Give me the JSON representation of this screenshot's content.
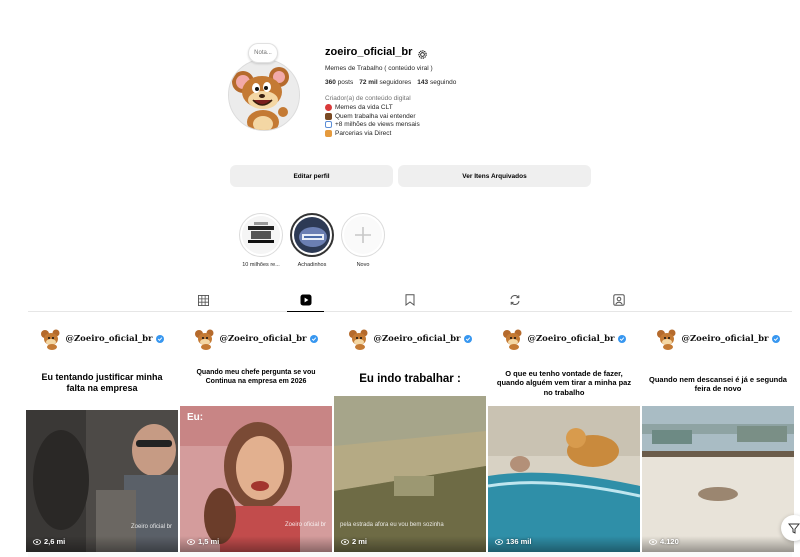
{
  "profile": {
    "note_label": "Nota...",
    "username": "zoeiro_oficial_br",
    "full_name": "Memes de Trabalho ( conteúdo viral )",
    "stats": {
      "posts_value": "360",
      "posts_label": "posts",
      "followers_value": "72 mil",
      "followers_label": "seguidores",
      "following_value": "143",
      "following_label": "seguindo"
    },
    "category": "Criador(a) de conteúdo digital",
    "bio": [
      {
        "icon": "lips-emoji-icon",
        "color": "#d93a3a",
        "text": "Memes da vida CLT"
      },
      {
        "icon": "briefcase-emoji-icon",
        "color": "#7a4a24",
        "text": "Quem trabalha vai entender"
      },
      {
        "icon": "chart-emoji-icon",
        "color": "#5b8dd6",
        "text": "+8 milhões de views mensais"
      },
      {
        "icon": "raised-hand-emoji-icon",
        "color": "#e59a3d",
        "text": "Parcerias via Direct"
      }
    ],
    "buttons": {
      "edit": "Editar perfil",
      "archive": "Ver Itens Arquivados"
    }
  },
  "highlights": [
    {
      "label": "10 milhões re..."
    },
    {
      "label": "Achadinhos"
    },
    {
      "label": "Novo"
    }
  ],
  "tabs": [
    {
      "name": "posts",
      "icon": "grid-icon"
    },
    {
      "name": "reels",
      "icon": "reels-icon",
      "active": true
    },
    {
      "name": "saved",
      "icon": "bookmark-icon"
    },
    {
      "name": "reposts",
      "icon": "repost-icon"
    },
    {
      "name": "tagged",
      "icon": "tagged-icon"
    }
  ],
  "reels": [
    {
      "handle": "@Zoeiro_oficial_br",
      "caption": "Eu tentando justificar minha falta na empresa",
      "overlay": "",
      "watermark": "Zoeiro oficial br",
      "views": "2,6 mi"
    },
    {
      "handle": "@Zoeiro_oficial_br",
      "caption": "Quando  meu chefe pergunta  se vou Continua na empresa em 2026",
      "overlay": "Eu:",
      "watermark": "Zoeiro oficial br",
      "views": "1,5 mi"
    },
    {
      "handle": "@Zoeiro_oficial_br",
      "caption": "Eu indo trabalhar :",
      "overlay": "",
      "watermark": "pela estrada afora eu vou bem sozinha",
      "views": "2 mi"
    },
    {
      "handle": "@Zoeiro_oficial_br",
      "caption": "O que eu tenho vontade de fazer, quando alguém vem tirar a minha paz no trabalho",
      "overlay": "",
      "watermark": "",
      "views": "136 mil"
    },
    {
      "handle": "@Zoeiro_oficial_br",
      "caption": "Quando nem descansei é já e segunda feira de novo",
      "overlay": "",
      "watermark": "",
      "views": "4.120"
    }
  ],
  "colors": {
    "verified": "#3897f0",
    "button_bg": "#efefef",
    "muted_text": "#737373"
  }
}
